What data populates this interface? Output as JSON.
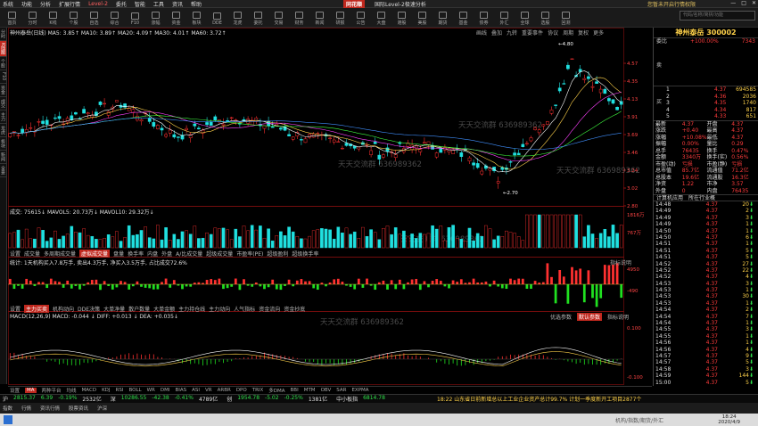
{
  "menubar": {
    "items": [
      "系统",
      "功能",
      "分析",
      "扩展行情",
      "Level-2",
      "委托",
      "智能",
      "工具",
      "资讯",
      "帮助"
    ],
    "brand": "同花顺",
    "subtitle": "国际Level-2极速分析",
    "account": "您暂未开启行情权限"
  },
  "toolbar": {
    "tools": [
      "首页",
      "分时",
      "K线",
      "个股",
      "自选",
      "综合",
      "F10",
      "涨幅",
      "资金",
      "板块",
      "DDE",
      "龙虎",
      "委托",
      "交易",
      "财务",
      "新闻",
      "研报",
      "公告",
      "大盘",
      "港股",
      "美股",
      "期货",
      "基金",
      "债券",
      "外汇",
      "全球",
      "选股",
      "回测"
    ],
    "search_placeholder": "代码/名称/简拼/功能"
  },
  "left_tabs": [
    "分时",
    "K线图",
    "个股",
    "F10",
    "资金",
    "成交",
    "主力",
    "龙虎",
    "板块",
    "新闻",
    "全景"
  ],
  "main": {
    "legend": "神州泰岳(日线) MA5: 3.85↑ MA10: 3.89↑ MA20: 4.09↑ MA30: 4.01↑ MA60: 3.72↑",
    "topright_tabs": [
      "画线",
      "叠加",
      "九转",
      "重要事件",
      "协议",
      "周期",
      "复权",
      "更多"
    ],
    "high_label": "4.80",
    "low_label": "2.70",
    "watermarks": [
      "天天交流群 636989362",
      "天天交流群 636989362",
      "天天交流群 636989362",
      "天天交流群 636989362",
      "天天交流群 636989362"
    ],
    "price_ticks": [
      "4.57",
      "4.35",
      "4.13",
      "3.91",
      "3.69",
      "3.46",
      "3.24",
      "3.02",
      "2.80"
    ],
    "vol_legend": "成交: 75615↓ MAVOL5: 20.73万↓ MAVOL10: 29.32万↓",
    "vol_ticks": [
      "1816万",
      "767万"
    ],
    "indicator_tabs": [
      "设置",
      "成交量",
      "多周期成交量",
      "虚拟成交量",
      "盘量",
      "换手率",
      "内盘",
      "外盘",
      "A/比成交量",
      "超级成交量",
      "市盈率(PE)",
      "超级盈利",
      "超级换手率"
    ],
    "fund_legend": "统计: 1天机构买入7.8万手, 卖出4.3万手, 净买入3.5万手, 占比成交72.6%",
    "fund_label": "指标说明",
    "fund_ticks": [
      "4950",
      "-490"
    ],
    "fund_tabs": [
      "设置",
      "主力买卖",
      "机构动向",
      "DDE决策",
      "大单净量",
      "散户数量",
      "大单金额",
      "主力持仓线",
      "主力动向",
      "人气指标",
      "资金流向",
      "资金抄底"
    ],
    "macd_legend": "MACD(12,26,9) MACD: -0.044 ↓ DIFF: +0.013 ↓ DEA: +0.035↓",
    "macd_buttons": [
      "优选参数",
      "默认参数",
      "指标说明"
    ],
    "macd_ticks": [
      "0.100",
      "-0.100"
    ]
  },
  "chart_data": {
    "type": "candlestick",
    "title": "神州泰岳",
    "ylim": [
      2.6,
      4.9
    ],
    "high": 4.8,
    "low": 2.7,
    "ma_names": [
      "MA5",
      "MA10",
      "MA20",
      "MA30",
      "MA60"
    ],
    "ma_last": [
      3.85,
      3.89,
      4.09,
      4.01,
      3.72
    ]
  },
  "panel": {
    "title": "神州泰岳 300002",
    "ratio_label": "委比",
    "ratio_value": "+100.00%",
    "ratio_diff": "7343",
    "sell_label": "卖",
    "buy_label": "买",
    "buys": [
      {
        "lvl": "1",
        "price": "4.37",
        "vol": "694585"
      },
      {
        "lvl": "2",
        "price": "4.36",
        "vol": "2036"
      },
      {
        "lvl": "3",
        "price": "4.35",
        "vol": "1740"
      },
      {
        "lvl": "4",
        "price": "4.34",
        "vol": "817"
      },
      {
        "lvl": "5",
        "price": "4.33",
        "vol": "651"
      }
    ],
    "stats": [
      {
        "k1": "最新",
        "v1": "4.37",
        "k2": "开盘",
        "v2": "4.37"
      },
      {
        "k1": "涨跌",
        "v1": "+0.40",
        "k2": "最高",
        "v2": "4.37"
      },
      {
        "k1": "涨幅",
        "v1": "+10.08%",
        "k2": "最低",
        "v2": "4.37"
      },
      {
        "k1": "振幅",
        "v1": "0.00%",
        "k2": "量比",
        "v2": "0.29"
      },
      {
        "k1": "总手",
        "v1": "76435",
        "k2": "换手",
        "v2": "0.47%"
      },
      {
        "k1": "金额",
        "v1": "3340万",
        "k2": "换手(实)",
        "v2": "0.56%"
      },
      {
        "k1": "市盈(动)",
        "v1": "亏损",
        "k2": "市盈(静)",
        "v2": "亏损"
      },
      {
        "k1": "总市值",
        "v1": "85.7亿",
        "k2": "流通值",
        "v2": "71.2亿"
      },
      {
        "k1": "总股本",
        "v1": "19.6亿",
        "k2": "流通股",
        "v2": "16.3亿"
      },
      {
        "k1": "净资",
        "v1": "1.22",
        "k2": "市净",
        "v2": "3.57"
      },
      {
        "k1": "外盘",
        "v1": "0",
        "k2": "内盘",
        "v2": "76435"
      }
    ],
    "tabs": [
      "计算机应用",
      "所在行业概"
    ],
    "ticks": [
      {
        "t": "14:48",
        "p": "4.37",
        "v": "20"
      },
      {
        "t": "14:49",
        "p": "4.37",
        "v": "2"
      },
      {
        "t": "14:49",
        "p": "4.37",
        "v": "3"
      },
      {
        "t": "14:49",
        "p": "4.37",
        "v": "1"
      },
      {
        "t": "14:50",
        "p": "4.37",
        "v": "1"
      },
      {
        "t": "14:50",
        "p": "4.37",
        "v": "6"
      },
      {
        "t": "14:51",
        "p": "4.37",
        "v": "1"
      },
      {
        "t": "14:51",
        "p": "4.37",
        "v": "5"
      },
      {
        "t": "14:51",
        "p": "4.37",
        "v": "5"
      },
      {
        "t": "14:52",
        "p": "4.37",
        "v": "27"
      },
      {
        "t": "14:52",
        "p": "4.37",
        "v": "22"
      },
      {
        "t": "14:52",
        "p": "4.37",
        "v": "4"
      },
      {
        "t": "14:53",
        "p": "4.37",
        "v": "3"
      },
      {
        "t": "14:53",
        "p": "4.37",
        "v": "1"
      },
      {
        "t": "14:53",
        "p": "4.37",
        "v": "30"
      },
      {
        "t": "14:53",
        "p": "4.37",
        "v": "1"
      },
      {
        "t": "14:54",
        "p": "4.37",
        "v": "2"
      },
      {
        "t": "14:54",
        "p": "4.37",
        "v": "7"
      },
      {
        "t": "14:54",
        "p": "4.37",
        "v": "1"
      },
      {
        "t": "14:55",
        "p": "4.37",
        "v": "3"
      },
      {
        "t": "14:55",
        "p": "4.37",
        "v": "1"
      },
      {
        "t": "14:56",
        "p": "4.37",
        "v": "1"
      },
      {
        "t": "14:56",
        "p": "4.37",
        "v": "4"
      },
      {
        "t": "14:57",
        "p": "4.37",
        "v": "9"
      },
      {
        "t": "14:57",
        "p": "4.37",
        "v": "5"
      },
      {
        "t": "14:58",
        "p": "4.37",
        "v": "3"
      },
      {
        "t": "14:59",
        "p": "4.37",
        "v": "144"
      },
      {
        "t": "15:00",
        "p": "4.37",
        "v": "5"
      }
    ],
    "bottom_tabs": [
      "分",
      "价",
      "盘",
      "L2",
      "图",
      "筹"
    ]
  },
  "bottom_tabs": [
    "设置",
    "MA",
    "两种平台",
    "均线",
    "MACD",
    "KDJ",
    "RSI",
    "BOLL",
    "WR",
    "DMI",
    "BIAS",
    "ASI",
    "VR",
    "ARBR",
    "DPO",
    "TRIX",
    "多DMA",
    "BBI",
    "MTM",
    "OBV",
    "SAR",
    "EXPMA"
  ],
  "ticker": [
    {
      "name": "沪",
      "val": "2815.37",
      "chg": "6.39",
      "pct": "-0.19%",
      "amt": "2532亿"
    },
    {
      "name": "深",
      "val": "10286.55",
      "chg": "-42.38",
      "pct": "-0.41%",
      "amt": "4789亿"
    },
    {
      "name": "创",
      "val": "1954.78",
      "chg": "-5.02",
      "pct": "-0.25%",
      "amt": "1381亿"
    },
    {
      "name": "中小板指",
      "val": "6814.78",
      "chg": "",
      "pct": "",
      "amt": ""
    }
  ],
  "news": "18:22 山东省日前新增总以上工业企业资产总计99.7% 计划一季度新开工项目2877个",
  "status": [
    "指数",
    "行情",
    "资讯行情",
    "股票资讯",
    "沪深"
  ],
  "taskbar": {
    "search": "机构/指数/期货/外汇",
    "time": "18:24",
    "date": "2020/4/9"
  }
}
